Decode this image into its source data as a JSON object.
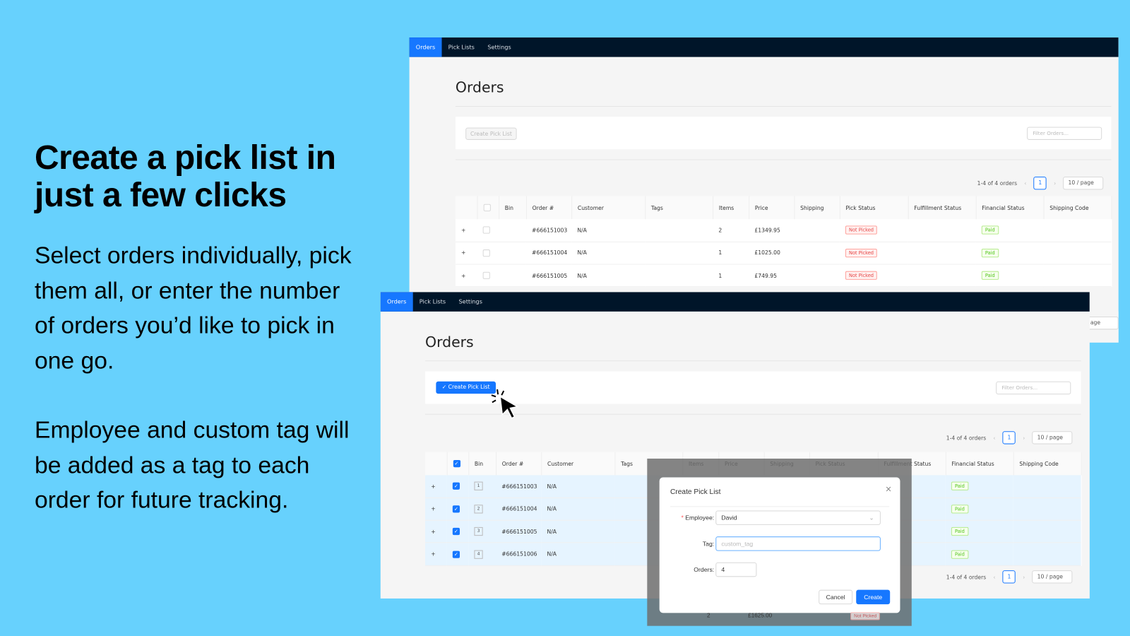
{
  "hero": {
    "title": "Create a pick list in just a few clicks",
    "p1": "Select orders individually, pick them all, or enter the number of orders you’d like to pick in one go.",
    "p2": "Employee and custom tag will be added as a tag to each order for future tracking."
  },
  "nav": {
    "tabs": [
      "Orders",
      "Pick Lists",
      "Settings"
    ]
  },
  "page": {
    "title": "Orders",
    "create_button": "Create Pick List",
    "filter_placeholder": "Filter Orders...",
    "pagination": "1-4 of 4 orders",
    "page": "1",
    "page_size": "10 / page",
    "page_size_partial": "age"
  },
  "columns": [
    "",
    "",
    "Bin",
    "Order #",
    "Customer",
    "Tags",
    "Items",
    "Price",
    "Shipping",
    "Pick Status",
    "Fulfillment Status",
    "Financial Status",
    "Shipping Code"
  ],
  "panel1_rows": [
    {
      "order": "#666151003",
      "customer": "N/A",
      "items": "2",
      "price": "£1349.95",
      "pick": "Not Picked",
      "financial": "Paid"
    },
    {
      "order": "#666151004",
      "customer": "N/A",
      "items": "1",
      "price": "£1025.00",
      "pick": "Not Picked",
      "financial": "Paid"
    },
    {
      "order": "#666151005",
      "customer": "N/A",
      "items": "1",
      "price": "£749.95",
      "pick": "Not Picked",
      "financial": "Paid"
    }
  ],
  "panel2_rows": [
    {
      "bin": "1",
      "order": "#666151003",
      "customer": "N/A",
      "financial": "Paid"
    },
    {
      "bin": "2",
      "order": "#666151004",
      "customer": "N/A",
      "financial": "Paid"
    },
    {
      "bin": "3",
      "order": "#666151005",
      "customer": "N/A",
      "financial": "Paid"
    },
    {
      "bin": "4",
      "order": "#666151006",
      "customer": "N/A",
      "financial": "Paid"
    }
  ],
  "modal": {
    "title": "Create Pick List",
    "employee_label": "Employee:",
    "employee_value": "David",
    "tag_label": "Tag:",
    "tag_placeholder": "custom_tag",
    "orders_label": "Orders:",
    "orders_value": "4",
    "cancel": "Cancel",
    "create": "Create"
  },
  "behind_row": {
    "items": "2",
    "price": "£1625.00",
    "pick": "Not Picked"
  },
  "colors": {
    "background": "#67d1fd",
    "nav": "#001529",
    "primary": "#1677ff"
  }
}
